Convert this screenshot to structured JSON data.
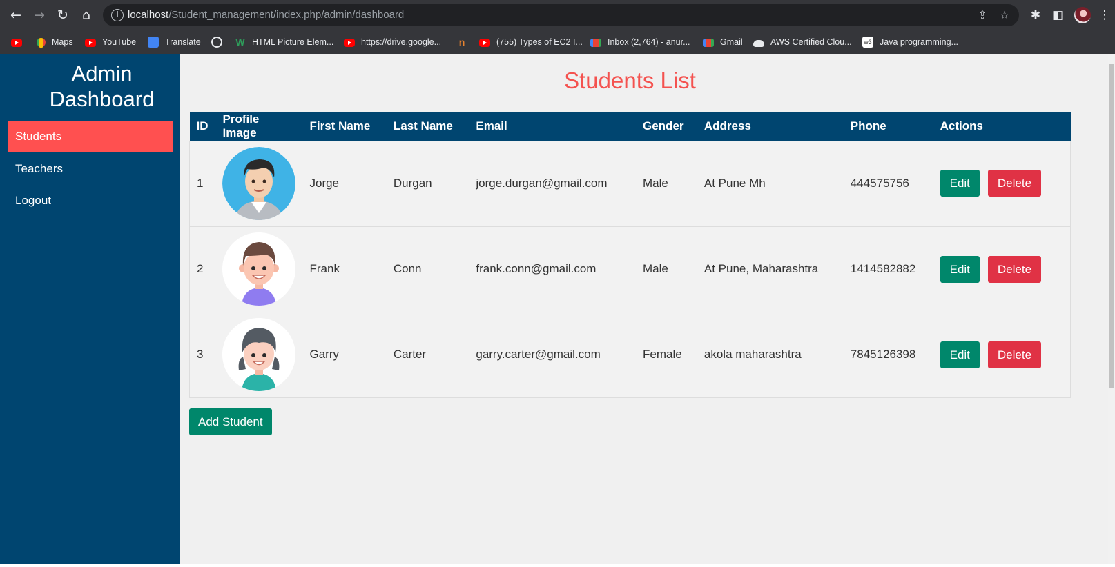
{
  "browser": {
    "url_host": "localhost",
    "url_path": "/Student_management/index.php/admin/dashboard",
    "bookmarks": [
      {
        "label": "",
        "icon": "youtube-icon"
      },
      {
        "label": "Maps",
        "icon": "maps-icon"
      },
      {
        "label": "YouTube",
        "icon": "youtube-icon"
      },
      {
        "label": "Translate",
        "icon": "translate-icon"
      },
      {
        "label": "",
        "icon": "globe-icon"
      },
      {
        "label": "HTML Picture Elem...",
        "icon": "w-icon"
      },
      {
        "label": "https://drive.google...",
        "icon": "youtube-icon"
      },
      {
        "label": "",
        "icon": "orange-n-icon"
      },
      {
        "label": "(755) Types of EC2 I...",
        "icon": "youtube-icon"
      },
      {
        "label": "Inbox (2,764) - anur...",
        "icon": "gmail-icon"
      },
      {
        "label": "Gmail",
        "icon": "gmail-icon"
      },
      {
        "label": "AWS Certified Clou...",
        "icon": "cloud-icon"
      },
      {
        "label": "Java programming...",
        "icon": "w3-icon"
      }
    ]
  },
  "sidebar": {
    "title": "Admin Dashboard",
    "items": [
      {
        "label": "Students",
        "active": true
      },
      {
        "label": "Teachers",
        "active": false
      },
      {
        "label": "Logout",
        "active": false
      }
    ]
  },
  "main": {
    "title": "Students List",
    "columns": [
      "ID",
      "Profile Image",
      "First Name",
      "Last Name",
      "Email",
      "Gender",
      "Address",
      "Phone",
      "Actions"
    ],
    "rows": [
      {
        "id": "1",
        "first_name": "Jorge",
        "last_name": "Durgan",
        "email": "jorge.durgan@gmail.com",
        "gender": "Male",
        "address": "At Pune Mh",
        "phone": "444575756",
        "avatar": "avatar-man-suit"
      },
      {
        "id": "2",
        "first_name": "Frank",
        "last_name": "Conn",
        "email": "frank.conn@gmail.com",
        "gender": "Male",
        "address": "At Pune, Maharashtra",
        "phone": "1414582882",
        "avatar": "avatar-boy"
      },
      {
        "id": "3",
        "first_name": "Garry",
        "last_name": "Carter",
        "email": "garry.carter@gmail.com",
        "gender": "Female",
        "address": "akola maharashtra",
        "phone": "7845126398",
        "avatar": "avatar-girl"
      }
    ],
    "edit_label": "Edit",
    "delete_label": "Delete",
    "add_label": "Add Student"
  },
  "colors": {
    "sidebar_bg": "#004570",
    "active_item": "#ff5050",
    "title": "#f4524f",
    "edit_button": "#00876b",
    "delete_button": "#e03245"
  }
}
